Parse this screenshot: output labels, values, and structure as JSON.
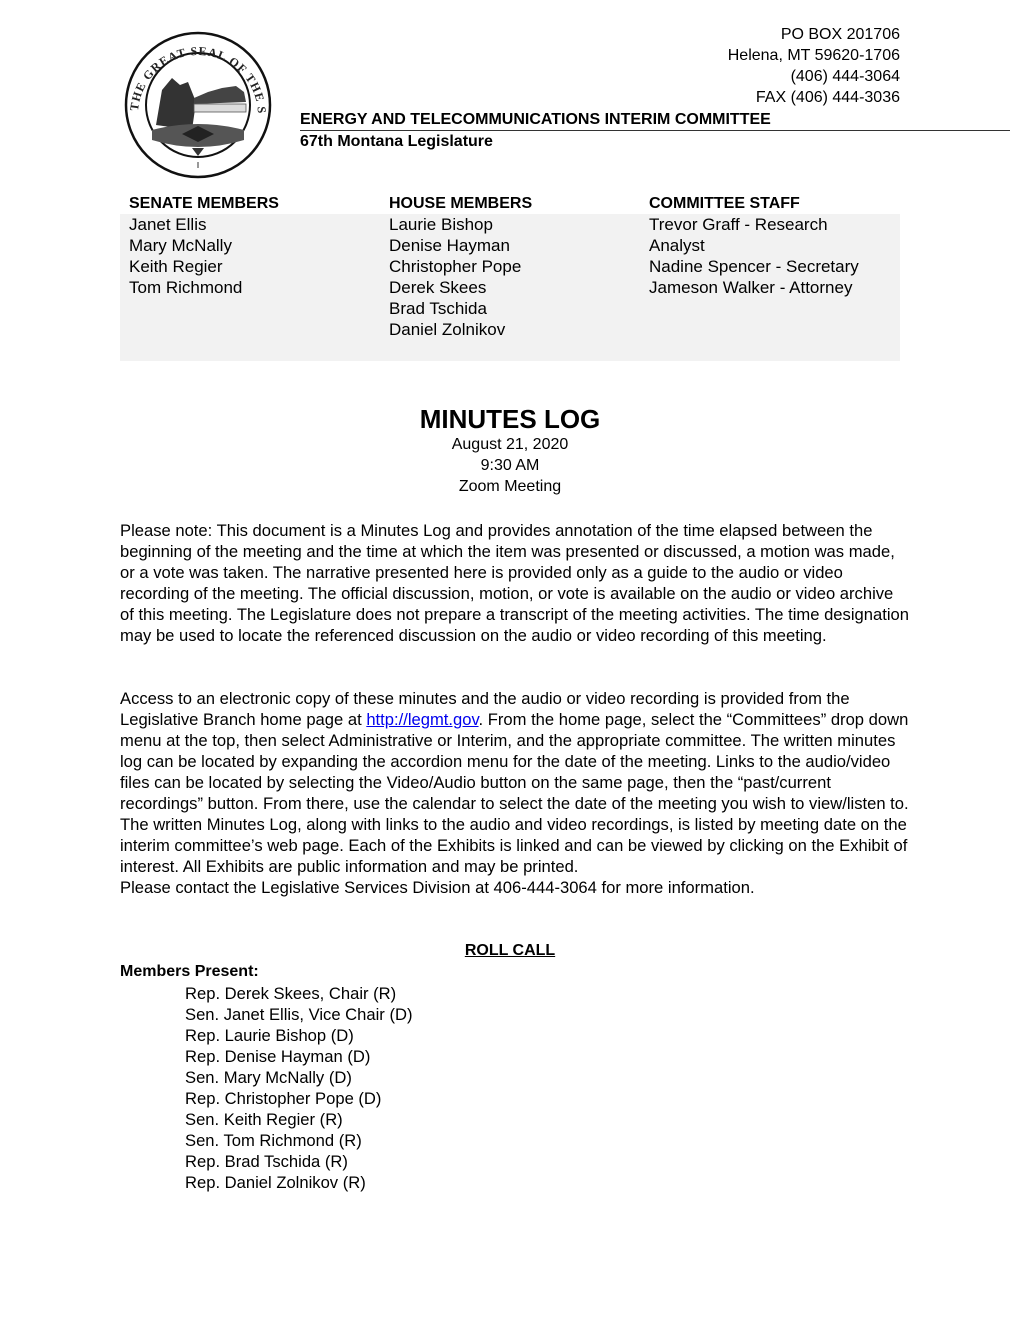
{
  "seal": {
    "icon": "montana-state-seal-icon",
    "caption": "The Great Seal of the State of Montana"
  },
  "address": {
    "po_box": "PO BOX 201706",
    "city": "Helena, MT 59620-1706",
    "phone": "(406) 444-3064",
    "fax": "FAX (406) 444-3036"
  },
  "committee": {
    "name": "ENERGY AND TELECOMMUNICATIONS INTERIM COMMITTEE",
    "legislature": "67th Montana Legislature"
  },
  "members": {
    "senate": {
      "heading": "SENATE MEMBERS",
      "names": [
        "Janet Ellis",
        "Mary McNally",
        "Keith Regier",
        "Tom Richmond"
      ]
    },
    "house": {
      "heading": "HOUSE MEMBERS",
      "names": [
        "Laurie Bishop",
        "Denise Hayman",
        "Christopher Pope",
        "Derek Skees",
        "Brad Tschida",
        "Daniel Zolnikov"
      ]
    },
    "staff": {
      "heading": "COMMITTEE STAFF",
      "lines": [
        "Trevor Graff - Research",
        "Analyst",
        "Nadine Spencer - Secretary",
        "Jameson Walker - Attorney"
      ]
    }
  },
  "minutes": {
    "title": "MINUTES LOG",
    "date": "August 21, 2020",
    "time": "9:30 AM",
    "location": "Zoom Meeting"
  },
  "note_paragraph": "Please note: This document is a Minutes Log and provides annotation of the time elapsed between the beginning of the meeting and the time at which the item was presented or discussed, a motion was made, or a vote was taken.  The narrative presented here is provided only as a guide to the audio or video recording of the meeting.  The official discussion, motion, or vote is available on the audio or video archive of this meeting.  The Legislature does not prepare a transcript of the meeting activities.  The time designation may be used to locate the referenced discussion on the audio or video recording of this meeting.",
  "access_paragraph": {
    "before_link": "Access to an electronic copy of these minutes and the audio or video recording is provided from the Legislative Branch home page at ",
    "link_text": "http://legmt.gov",
    "after_link": ". From the home page, select the “Committees” drop down menu at the top, then select Administrative or Interim, and the appropriate committee. The written minutes log can be located by expanding the accordion menu for the date of the meeting. Links to the audio/video files can be located by selecting the Video/Audio button on the same page, then the “past/current recordings” button. From there, use the calendar to select the date of the meeting you wish to view/listen to. The written Minutes Log, along with links to the audio and video recordings, is listed by meeting date on the interim committee’s web page. Each of the Exhibits is linked and can be viewed by clicking on the Exhibit of interest. All Exhibits are public information and may be printed.",
    "contact": "Please contact the Legislative Services Division at 406-444-3064 for more information.",
    "link_color": "#0000ee"
  },
  "roll_call": {
    "heading": "ROLL CALL",
    "present_label": "Members Present:",
    "present": [
      "Rep. Derek Skees, Chair (R)",
      "Sen. Janet Ellis, Vice Chair (D)",
      "Rep. Laurie Bishop (D)",
      "Rep. Denise Hayman (D)",
      "Sen. Mary McNally (D)",
      "Rep. Christopher Pope (D)",
      "Sen. Keith Regier (R)",
      "Sen. Tom Richmond (R)",
      "Rep. Brad Tschida (R)",
      "Rep. Daniel Zolnikov (R)"
    ]
  }
}
